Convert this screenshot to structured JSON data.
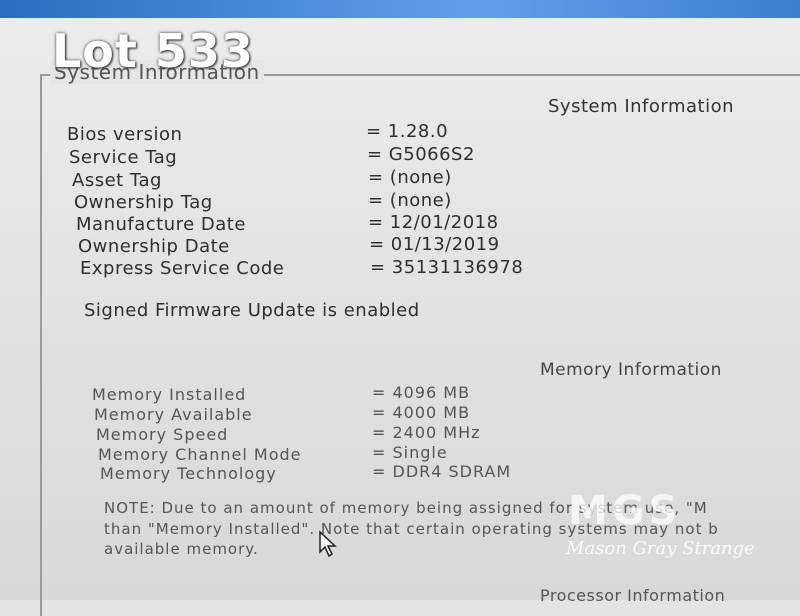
{
  "overlay": {
    "lot_label": "Lot 533"
  },
  "group_title": "System Information",
  "system": {
    "header": "System Information",
    "rows": [
      {
        "label": "Bios version",
        "value": "= 1.28.0"
      },
      {
        "label": "Service Tag",
        "value": "= G5066S2"
      },
      {
        "label": "Asset Tag",
        "value": "= (none)"
      },
      {
        "label": "Ownership Tag",
        "value": "= (none)"
      },
      {
        "label": "Manufacture Date",
        "value": "= 12/01/2018"
      },
      {
        "label": "Ownership Date",
        "value": "= 01/13/2019"
      },
      {
        "label": "Express Service Code",
        "value": "= 35131136978"
      }
    ],
    "firmware_status": "Signed Firmware Update is enabled"
  },
  "memory": {
    "header": "Memory Information",
    "rows": [
      {
        "label": "Memory Installed",
        "value": "= 4096 MB"
      },
      {
        "label": "Memory Available",
        "value": "= 4000 MB"
      },
      {
        "label": "Memory Speed",
        "value": "= 2400 MHz"
      },
      {
        "label": "Memory Channel Mode",
        "value": "= Single"
      },
      {
        "label": "Memory Technology",
        "value": "= DDR4 SDRAM"
      }
    ],
    "note_lines": [
      "NOTE: Due to an amount of memory being assigned for system use, \"M",
      "than \"Memory Installed\". Note that certain operating systems may not b",
      "available memory."
    ]
  },
  "processor": {
    "header": "Processor Information"
  },
  "watermark": {
    "logo": "MGS",
    "text": "Mason Gray Strange"
  },
  "colors": {
    "title_bar": "#3c7fd0",
    "screen_bg": "#e4e4e0",
    "text": "#2f2f2f"
  }
}
